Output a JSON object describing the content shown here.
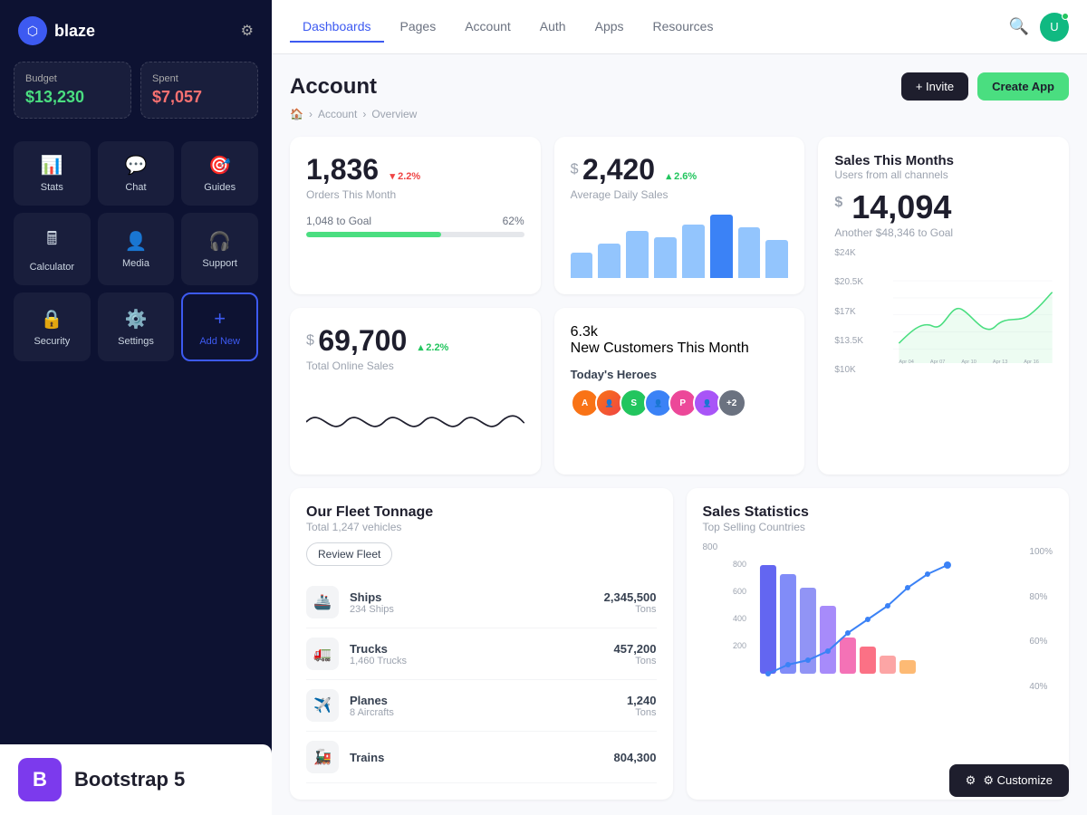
{
  "sidebar": {
    "logo": {
      "text": "blaze",
      "icon": "⬡"
    },
    "budget": {
      "label": "Budget",
      "value": "$13,230",
      "value_color": "green"
    },
    "spent": {
      "label": "Spent",
      "value": "$7,057",
      "value_color": "red"
    },
    "nav_items": [
      {
        "id": "stats",
        "label": "Stats",
        "icon": "📊"
      },
      {
        "id": "chat",
        "label": "Chat",
        "icon": "💬"
      },
      {
        "id": "guides",
        "label": "Guides",
        "icon": "🎯"
      },
      {
        "id": "calculator",
        "label": "Calculator",
        "icon": "🖩"
      },
      {
        "id": "media",
        "label": "Media",
        "icon": "👤"
      },
      {
        "id": "support",
        "label": "Support",
        "icon": "🎧"
      },
      {
        "id": "security",
        "label": "Security",
        "icon": "🔒"
      },
      {
        "id": "settings",
        "label": "Settings",
        "icon": "⚙️"
      },
      {
        "id": "add-new",
        "label": "Add New",
        "icon": "+"
      }
    ],
    "bootstrap": {
      "letter": "B",
      "text": "Bootstrap 5"
    }
  },
  "topnav": {
    "tabs": [
      {
        "id": "dashboards",
        "label": "Dashboards",
        "active": true
      },
      {
        "id": "pages",
        "label": "Pages"
      },
      {
        "id": "account",
        "label": "Account"
      },
      {
        "id": "auth",
        "label": "Auth"
      },
      {
        "id": "apps",
        "label": "Apps"
      },
      {
        "id": "resources",
        "label": "Resources"
      }
    ]
  },
  "page": {
    "title": "Account",
    "breadcrumb": {
      "home": "🏠",
      "items": [
        "Account",
        "Overview"
      ]
    },
    "invite_label": "+ Invite",
    "create_app_label": "Create App"
  },
  "stats": {
    "orders": {
      "number": "1,836",
      "label": "Orders This Month",
      "badge": "▾ 2.2%",
      "badge_type": "down",
      "progress_label": "1,048 to Goal",
      "progress_pct": "62%",
      "progress_value": 62
    },
    "daily_sales": {
      "prefix": "$",
      "number": "2,420",
      "label": "Average Daily Sales",
      "badge": "▴ 2.6%",
      "badge_type": "up"
    },
    "sales_month": {
      "title": "Sales This Months",
      "subtitle": "Users from all channels",
      "prefix": "$",
      "amount": "14,094",
      "sub": "Another $48,346 to Goal",
      "labels": [
        "$24K",
        "$20.5K",
        "$17K",
        "$13.5K",
        "$10K"
      ],
      "x_labels": [
        "Apr 04",
        "Apr 07",
        "Apr 10",
        "Apr 13",
        "Apr 16"
      ]
    },
    "online_sales": {
      "prefix": "$",
      "number": "69,700",
      "label": "Total Online Sales",
      "badge": "▴ 2.2%",
      "badge_type": "up"
    },
    "new_customers": {
      "number": "6.3k",
      "label": "New Customers This Month",
      "heroes_title": "Today's Heroes"
    }
  },
  "fleet": {
    "title": "Our Fleet Tonnage",
    "subtitle": "Total 1,247 vehicles",
    "review_btn": "Review Fleet",
    "items": [
      {
        "icon": "🚢",
        "name": "Ships",
        "count": "234 Ships",
        "amount": "2,345,500",
        "unit": "Tons"
      },
      {
        "icon": "🚛",
        "name": "Trucks",
        "count": "1,460 Trucks",
        "amount": "457,200",
        "unit": "Tons"
      },
      {
        "icon": "✈️",
        "name": "Planes",
        "count": "8 Aircrafts",
        "amount": "1,240",
        "unit": "Tons"
      },
      {
        "icon": "🚂",
        "name": "Trains",
        "count": "",
        "amount": "804,300",
        "unit": ""
      }
    ]
  },
  "sales_stats": {
    "title": "Sales Statistics",
    "subtitle": "Top Selling Countries",
    "y_labels": [
      "800",
      "600",
      "400",
      "200",
      ""
    ],
    "pct_labels": [
      "100%",
      "80%",
      "60%",
      "40%"
    ]
  },
  "customize_btn": "⚙ Customize"
}
